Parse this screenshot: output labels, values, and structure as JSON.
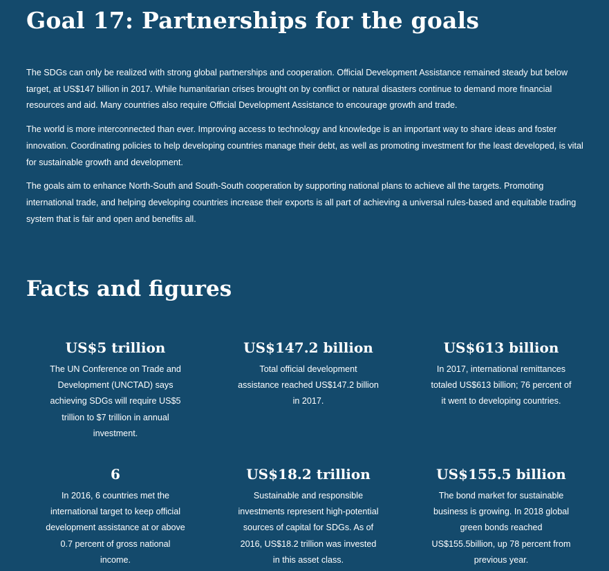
{
  "goal": {
    "title": "Goal 17: Partnerships for the goals",
    "paragraphs": [
      "The SDGs can only be realized with strong global partnerships and cooperation. Official Development Assistance remained steady but below target, at US$147 billion in 2017. While humanitarian crises brought on by conflict or natural disasters continue to demand more financial resources and aid. Many countries also require Official Development Assistance to encourage growth and trade.",
      "The world is more interconnected than ever. Improving access to technology and knowledge is an important way to share ideas and foster innovation. Coordinating policies to help developing countries manage their debt, as well as promoting investment for the least developed, is vital for sustainable growth and development.",
      "The goals aim to enhance North-South and South-South cooperation by supporting national plans to achieve all the targets. Promoting international trade, and helping developing countries increase their exports is all part of achieving a universal rules-based and equitable trading system that is fair and open and benefits all."
    ]
  },
  "facts": {
    "title": "Facts and figures",
    "items": [
      {
        "value": "US$5 trillion",
        "description": "The UN Conference on Trade and Development (UNCTAD) says achieving SDGs will require US$5 trillion to $7 trillion in annual investment."
      },
      {
        "value": "US$147.2 billion",
        "description": "Total official development assistance reached US$147.2 billion in 2017."
      },
      {
        "value": "US$613 billion",
        "description": "In 2017, international remittances totaled US$613 billion; 76 percent of it went to developing countries."
      },
      {
        "value": "6",
        "description": "In 2016, 6 countries met the international target to keep official development assistance at or above 0.7 percent of gross national income."
      },
      {
        "value": "US$18.2 trillion",
        "description": "Sustainable and responsible investments represent high-potential sources of capital for SDGs. As of 2016, US$18.2 trillion was invested in this asset class."
      },
      {
        "value": "US$155.5 billion",
        "description": "The bond market for sustainable business is growing. In 2018 global green bonds reached US$155.5billion, up 78 percent from previous year."
      }
    ]
  },
  "colors": {
    "background": "#144a6c",
    "text": "#ffffff"
  }
}
